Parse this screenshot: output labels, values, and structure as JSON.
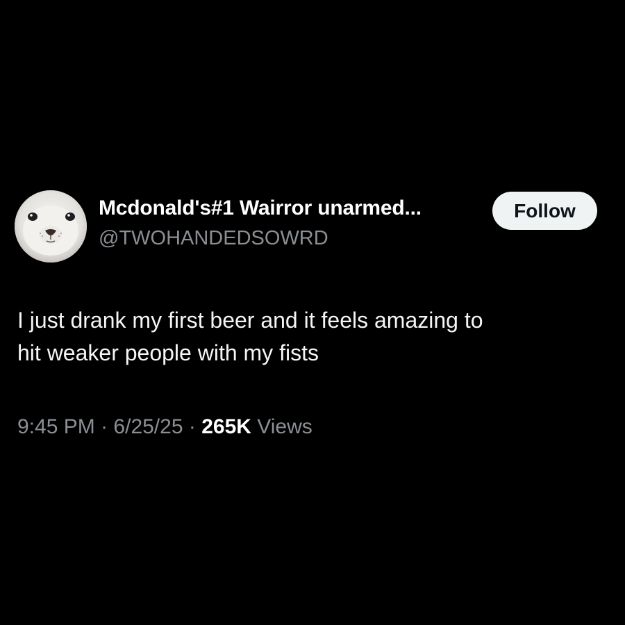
{
  "author": {
    "display_name": "Mcdonald's#1 Wairror unarmed...",
    "handle": "@TWOHANDEDSOWRD",
    "avatar_icon": "seal-pup-avatar"
  },
  "follow_button": {
    "label": "Follow"
  },
  "tweet": {
    "text_line_1": "I just drank my first beer and it feels amazing to",
    "text_line_2": "hit weaker people with my fists"
  },
  "meta": {
    "time": "9:45 PM",
    "separator": "·",
    "date": "6/25/25",
    "views_count": "265K",
    "views_label": "Views"
  },
  "colors": {
    "background": "#000000",
    "primary_text": "#ffffff",
    "secondary_text": "#8b8f94",
    "follow_button_bg": "#eff3f4",
    "follow_button_text": "#0f1419"
  }
}
